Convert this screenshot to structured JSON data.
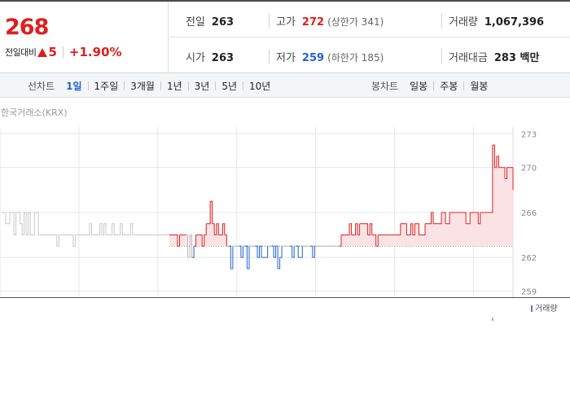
{
  "quote": {
    "price": "268",
    "change_label": "전일대비",
    "change_value": "5",
    "change_percent": "+1.90%",
    "direction": "up"
  },
  "stats": {
    "prev_close": {
      "label": "전일",
      "value": "263"
    },
    "high": {
      "label": "고가",
      "value": "272",
      "sub": "(상한가 341)"
    },
    "volume": {
      "label": "거래량",
      "value": "1,067,396"
    },
    "open": {
      "label": "시가",
      "value": "263"
    },
    "low": {
      "label": "저가",
      "value": "259",
      "sub": "(하한가 185)"
    },
    "trade_value": {
      "label": "거래대금",
      "value": "283 백만"
    }
  },
  "tabs": {
    "line_chart": {
      "title": "선차트",
      "items": [
        "1일",
        "1주일",
        "3개월",
        "1년",
        "3년",
        "5년",
        "10년"
      ],
      "active": "1일"
    },
    "candle_chart": {
      "title": "봉차트",
      "items": [
        "일봉",
        "주봉",
        "월봉"
      ]
    }
  },
  "source": "한국거래소(KRX)",
  "colors": {
    "up": "#e01e1e",
    "down": "#1f62d6",
    "neutral": "#c8c8c8",
    "volume": "#7a6cc4"
  },
  "chart_data": {
    "type": "line",
    "y_ticks": [
      "273",
      "270",
      "266",
      "262",
      "259"
    ],
    "ylim": [
      258.6,
      273.6
    ],
    "baseline": 263,
    "volume_legend": "거래량",
    "series": [
      {
        "values": [
          266,
          266,
          265,
          265,
          266,
          266,
          264,
          266,
          266,
          265,
          264,
          266,
          264,
          266,
          264,
          264,
          266,
          266,
          264,
          264,
          264,
          264,
          264,
          264,
          264,
          264,
          264,
          263,
          264,
          264,
          264,
          264,
          264,
          264,
          264,
          263,
          264,
          264,
          264,
          264,
          264,
          264,
          264,
          265,
          264,
          264,
          264,
          264,
          265,
          264,
          265,
          264,
          264,
          264,
          265,
          264,
          264,
          264,
          265,
          264,
          264,
          264,
          264,
          265,
          264,
          264,
          264,
          264,
          264,
          264,
          264,
          264,
          264,
          264,
          264,
          264,
          264,
          264,
          264,
          264,
          264,
          264,
          264,
          264,
          264,
          264,
          263,
          264,
          264,
          264,
          264,
          262,
          264,
          262,
          263,
          264,
          264,
          264,
          263,
          264,
          265,
          265,
          267,
          265,
          264,
          265,
          264,
          264,
          265,
          264,
          263,
          263,
          261,
          263,
          263,
          263,
          263,
          262,
          263,
          263,
          261,
          263,
          263,
          263,
          263,
          262,
          263,
          262,
          262,
          262,
          263,
          263,
          263,
          262,
          263,
          261,
          262,
          263,
          263,
          263,
          263,
          263,
          262,
          263,
          263,
          262,
          262,
          263,
          263,
          263,
          263,
          263,
          262,
          263,
          263,
          263,
          263,
          263,
          263,
          263,
          263,
          263,
          263,
          263,
          263,
          263,
          264,
          264,
          264,
          264,
          265,
          264,
          264,
          265,
          264,
          265,
          265,
          265,
          265,
          264,
          265,
          264,
          264,
          263,
          264,
          264,
          264,
          264,
          264,
          264,
          264,
          264,
          264,
          264,
          264,
          265,
          265,
          265,
          264,
          264,
          265,
          264,
          265,
          265,
          264,
          264,
          264,
          265,
          265,
          265,
          266,
          265,
          265,
          265,
          265,
          266,
          266,
          265,
          265,
          266,
          266,
          266,
          266,
          266,
          266,
          266,
          266,
          265,
          265,
          266,
          266,
          266,
          266,
          265,
          266,
          266,
          266,
          266,
          266,
          266,
          272,
          270,
          271,
          270,
          270,
          270,
          269,
          270,
          270,
          270,
          268
        ]
      }
    ],
    "volume": [
      0,
      0,
      0,
      0,
      0,
      0,
      0,
      0,
      0,
      0,
      0,
      0,
      0,
      0,
      0,
      0,
      0,
      0,
      0,
      0,
      0,
      0,
      0,
      0,
      0,
      0,
      0,
      0,
      0,
      0,
      0,
      0,
      0,
      0,
      0,
      0,
      0,
      0,
      0,
      0,
      0,
      0,
      0,
      0,
      0,
      0,
      0,
      0,
      0,
      0,
      0,
      0,
      0,
      0,
      0,
      0,
      0,
      0,
      0,
      0,
      0,
      0,
      0,
      0,
      0,
      0,
      0,
      0,
      0,
      0,
      0,
      0,
      0,
      0,
      0,
      0,
      0,
      0,
      0,
      0,
      0,
      0,
      0,
      0,
      0,
      0,
      0,
      0,
      0,
      0,
      0,
      0,
      0,
      0,
      0,
      0,
      0,
      0,
      0,
      0,
      0,
      0,
      0,
      0,
      0,
      0,
      0,
      0,
      0,
      0,
      0,
      0,
      0,
      0,
      0,
      0,
      0,
      0,
      0,
      0,
      0,
      0,
      0,
      0,
      0,
      0,
      0,
      0,
      0,
      0,
      0,
      0,
      0,
      0,
      0,
      0,
      0,
      0,
      0,
      0,
      0,
      0,
      0,
      0,
      0,
      0,
      0,
      0,
      0,
      0,
      0,
      0,
      0,
      0,
      0,
      0,
      0,
      0,
      0,
      0,
      0,
      0,
      0,
      0,
      0,
      0,
      0,
      0,
      0,
      0,
      0,
      0,
      0,
      0,
      0,
      0,
      0,
      0,
      0,
      0,
      0,
      0,
      0,
      0,
      0,
      0,
      0,
      0,
      0,
      0,
      0,
      0,
      0,
      0,
      0,
      0,
      0,
      0,
      0,
      0,
      0,
      0,
      0,
      0,
      0,
      0,
      0,
      0,
      0,
      0,
      0,
      0,
      0,
      0,
      0,
      0,
      0,
      0,
      0,
      0,
      0,
      0,
      0,
      0,
      0,
      0,
      0,
      0,
      0,
      0,
      0,
      0,
      0,
      0,
      0,
      0,
      0,
      0,
      0,
      0,
      4,
      0,
      0,
      0,
      0,
      0,
      0,
      0,
      0,
      0,
      0,
      0,
      0,
      0,
      0,
      0,
      0,
      0,
      0,
      0,
      0,
      0,
      0,
      0,
      0,
      0,
      0,
      0,
      0,
      0,
      0,
      0,
      0,
      0,
      0,
      0,
      0,
      0,
      0,
      0,
      0,
      0,
      0,
      0,
      0,
      0,
      0,
      0,
      0,
      0,
      0,
      0,
      0,
      0,
      0,
      0,
      0,
      0,
      0,
      0,
      0,
      0,
      0,
      0,
      0,
      0,
      0,
      0,
      0,
      0,
      0,
      0,
      0,
      0,
      0,
      0,
      0,
      0,
      0,
      0,
      0,
      0,
      0,
      0,
      0,
      0,
      0,
      0,
      0,
      0,
      0,
      0,
      0,
      0,
      0,
      0,
      0,
      0,
      0,
      0,
      0,
      0,
      0,
      0,
      0,
      0,
      0,
      0,
      0,
      0,
      0,
      0,
      0,
      0,
      0,
      0,
      0,
      0,
      0,
      0,
      20,
      6,
      0,
      0,
      0,
      0,
      0,
      0,
      0,
      0,
      0
    ]
  }
}
